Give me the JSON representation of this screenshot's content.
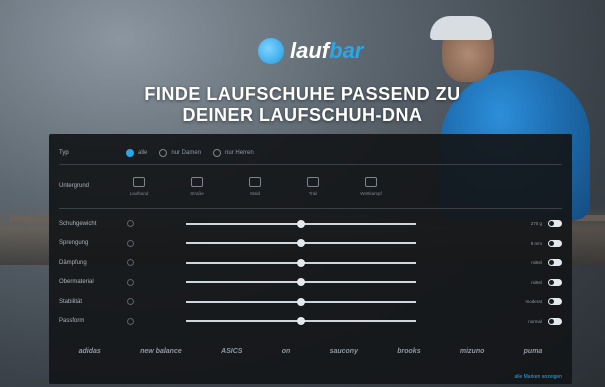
{
  "logo": {
    "text_main": "lauf",
    "text_accent": "bar"
  },
  "headline": {
    "line1": "FINDE LAUFSCHUHE PASSEND ZU",
    "line2": "DEINER LAUFSCHUH-DNA"
  },
  "type_row": {
    "label": "Typ",
    "options": [
      {
        "label": "alle",
        "active": true
      },
      {
        "label": "nur Damen",
        "active": false
      },
      {
        "label": "nur Herren",
        "active": false
      }
    ]
  },
  "ground_row": {
    "label": "Untergrund",
    "options": [
      "Laufband",
      "Straße",
      "Wald",
      "Trail",
      "Wettkampf"
    ]
  },
  "sliders": [
    {
      "label": "Schuhgewicht",
      "value_text": "270 g",
      "position": 0.5
    },
    {
      "label": "Sprengung",
      "value_text": "8 mm",
      "position": 0.5
    },
    {
      "label": "Dämpfung",
      "value_text": "mittel",
      "position": 0.5
    },
    {
      "label": "Obermaterial",
      "value_text": "mittel",
      "position": 0.5
    },
    {
      "label": "Stabilität",
      "value_text": "moderat",
      "position": 0.5
    },
    {
      "label": "Passform",
      "value_text": "normal",
      "position": 0.5
    }
  ],
  "brands": [
    "adidas",
    "new balance",
    "ASICS",
    "on",
    "saucony",
    "brooks",
    "mizuno",
    "puma"
  ],
  "cta": "alle Marken anzeigen"
}
